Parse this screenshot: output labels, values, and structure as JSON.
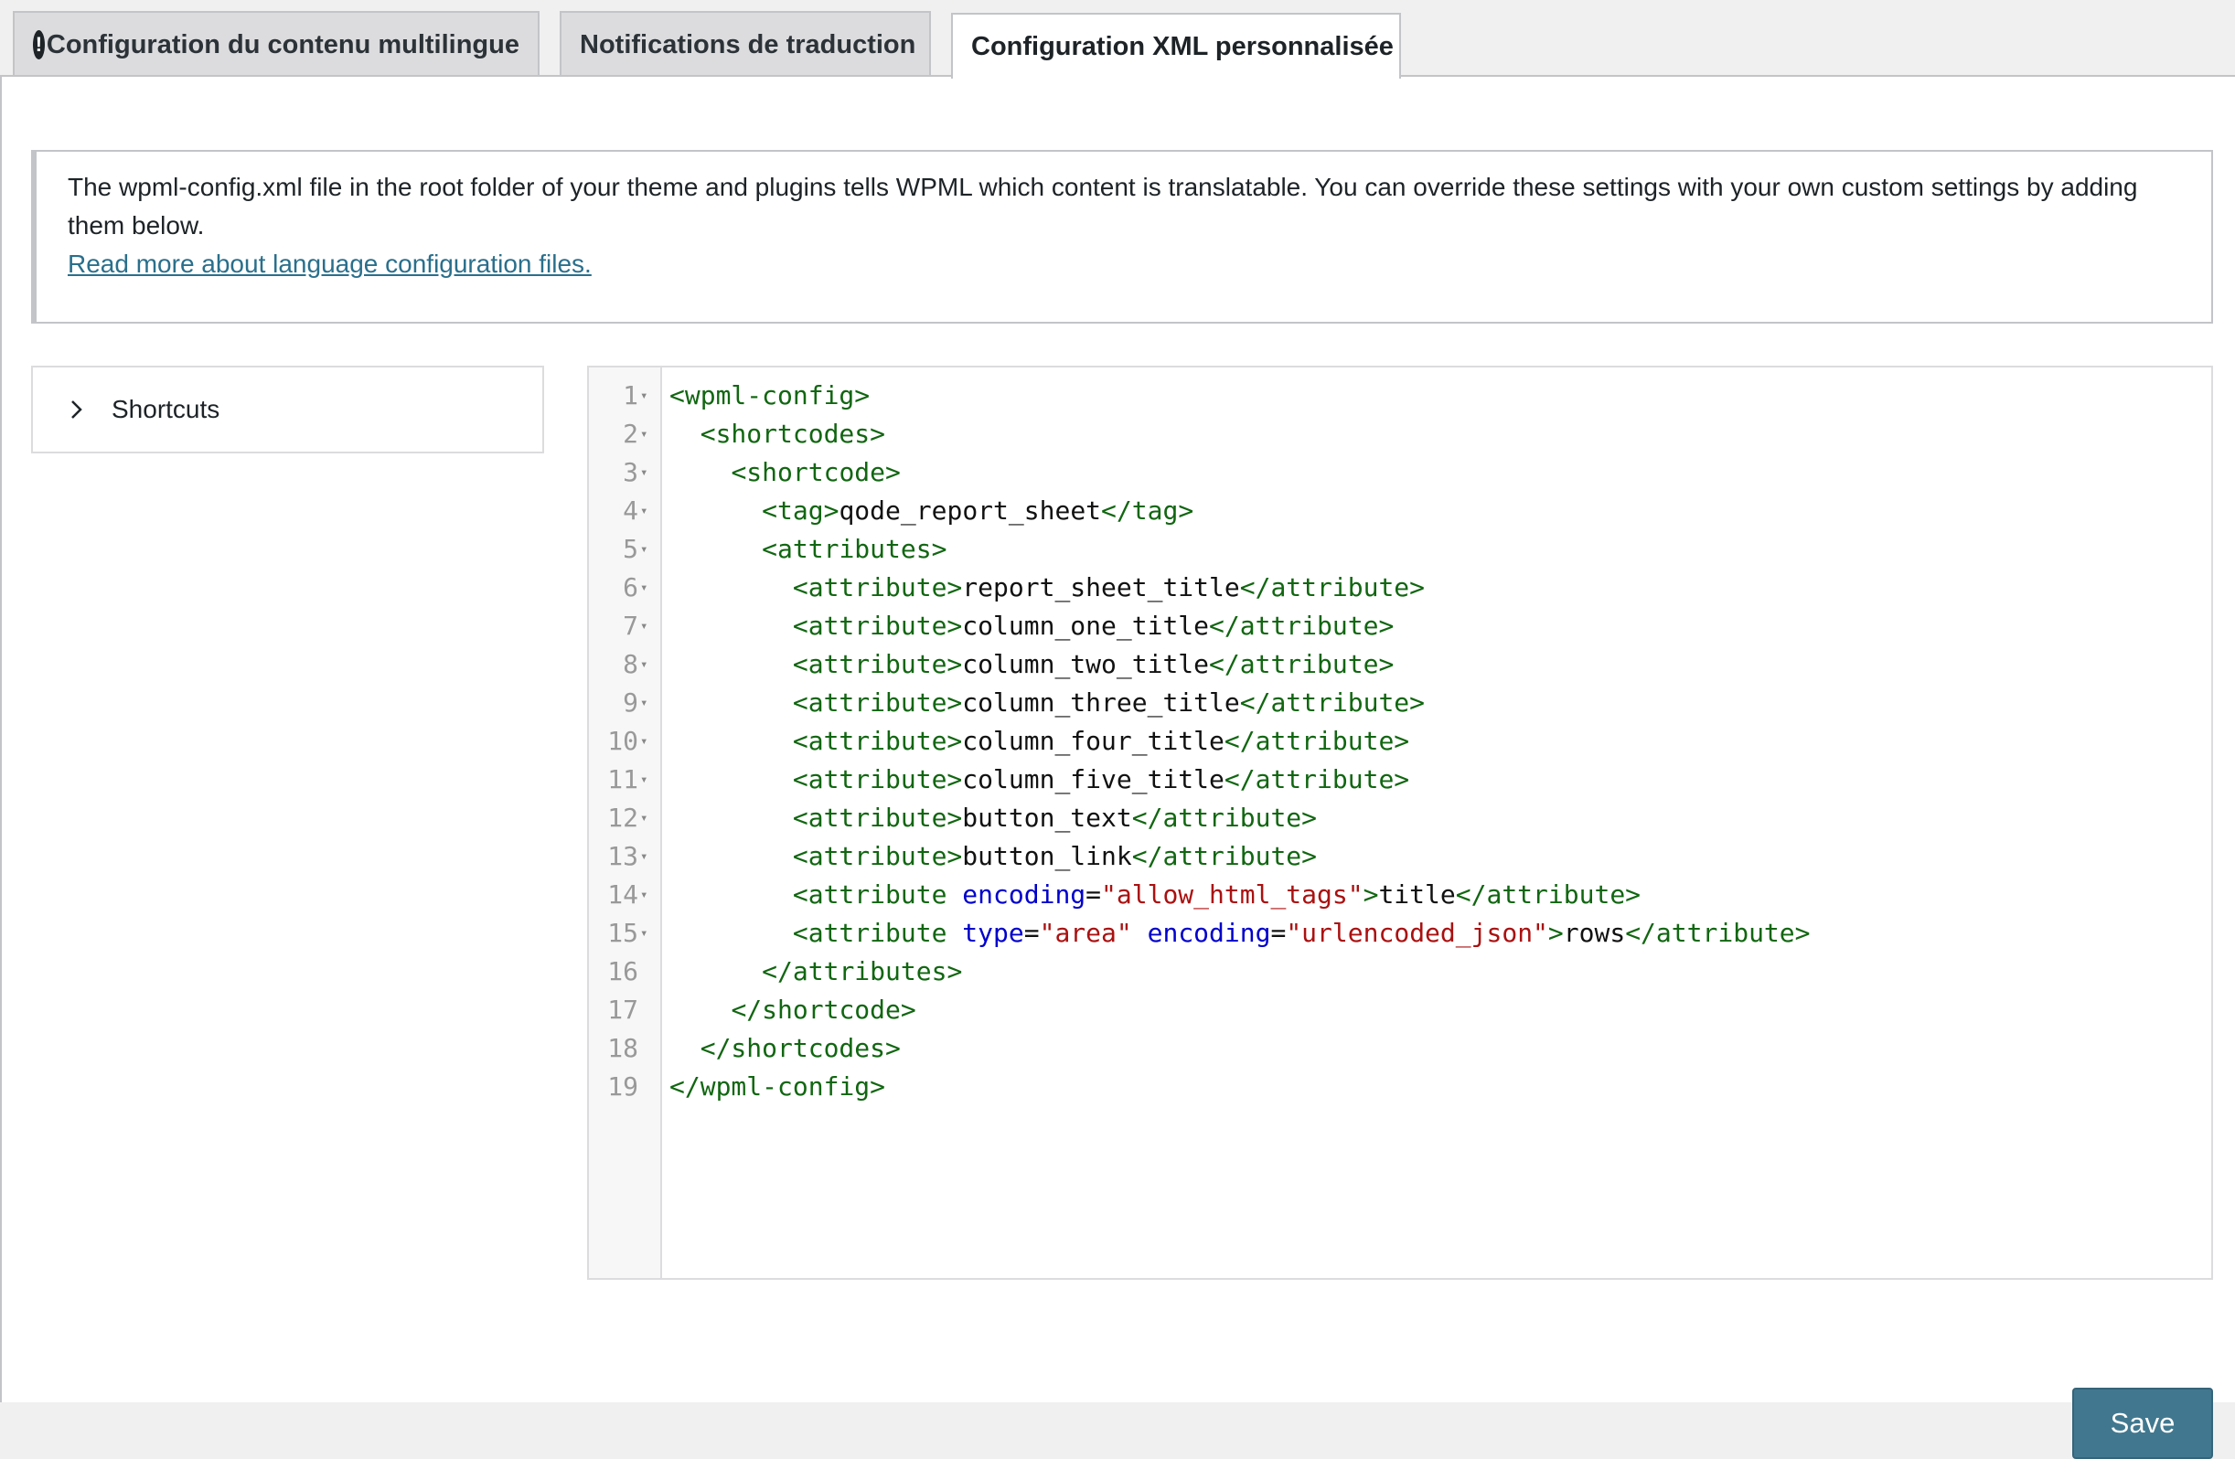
{
  "tabs": [
    {
      "label": "Configuration du contenu multilingue",
      "has_warning": true,
      "warning_glyph": "!"
    },
    {
      "label": "Notifications de traduction"
    },
    {
      "label": "Configuration XML personnalisée",
      "active": true
    }
  ],
  "notice": {
    "text": "The wpml-config.xml file in the root folder of your theme and plugins tells WPML which content is translatable. You can override these settings with your own custom settings by adding them below.",
    "link": "Read more about language configuration files."
  },
  "shortcuts": {
    "label": "Shortcuts",
    "icon": "chevron-right-icon"
  },
  "editor": {
    "lines": [
      {
        "n": "1",
        "fold": true,
        "indent": 0,
        "tokens": [
          [
            "tag",
            "<wpml-config>"
          ]
        ]
      },
      {
        "n": "2",
        "fold": true,
        "indent": 1,
        "tokens": [
          [
            "tag",
            "<shortcodes>"
          ]
        ]
      },
      {
        "n": "3",
        "fold": true,
        "indent": 2,
        "tokens": [
          [
            "tag",
            "<shortcode>"
          ]
        ]
      },
      {
        "n": "4",
        "fold": true,
        "indent": 3,
        "tokens": [
          [
            "tag",
            "<tag>"
          ],
          [
            "text",
            "qode_report_sheet"
          ],
          [
            "tag",
            "</tag>"
          ]
        ]
      },
      {
        "n": "5",
        "fold": true,
        "indent": 3,
        "tokens": [
          [
            "tag",
            "<attributes>"
          ]
        ]
      },
      {
        "n": "6",
        "fold": true,
        "indent": 4,
        "tokens": [
          [
            "tag",
            "<attribute>"
          ],
          [
            "text",
            "report_sheet_title"
          ],
          [
            "tag",
            "</attribute>"
          ]
        ]
      },
      {
        "n": "7",
        "fold": true,
        "indent": 4,
        "tokens": [
          [
            "tag",
            "<attribute>"
          ],
          [
            "text",
            "column_one_title"
          ],
          [
            "tag",
            "</attribute>"
          ]
        ]
      },
      {
        "n": "8",
        "fold": true,
        "indent": 4,
        "tokens": [
          [
            "tag",
            "<attribute>"
          ],
          [
            "text",
            "column_two_title"
          ],
          [
            "tag",
            "</attribute>"
          ]
        ]
      },
      {
        "n": "9",
        "fold": true,
        "indent": 4,
        "tokens": [
          [
            "tag",
            "<attribute>"
          ],
          [
            "text",
            "column_three_title"
          ],
          [
            "tag",
            "</attribute>"
          ]
        ]
      },
      {
        "n": "10",
        "fold": true,
        "indent": 4,
        "tokens": [
          [
            "tag",
            "<attribute>"
          ],
          [
            "text",
            "column_four_title"
          ],
          [
            "tag",
            "</attribute>"
          ]
        ]
      },
      {
        "n": "11",
        "fold": true,
        "indent": 4,
        "tokens": [
          [
            "tag",
            "<attribute>"
          ],
          [
            "text",
            "column_five_title"
          ],
          [
            "tag",
            "</attribute>"
          ]
        ]
      },
      {
        "n": "12",
        "fold": true,
        "indent": 4,
        "tokens": [
          [
            "tag",
            "<attribute>"
          ],
          [
            "text",
            "button_text"
          ],
          [
            "tag",
            "</attribute>"
          ]
        ]
      },
      {
        "n": "13",
        "fold": true,
        "indent": 4,
        "tokens": [
          [
            "tag",
            "<attribute>"
          ],
          [
            "text",
            "button_link"
          ],
          [
            "tag",
            "</attribute>"
          ]
        ]
      },
      {
        "n": "14",
        "fold": true,
        "indent": 4,
        "tokens": [
          [
            "tag",
            "<attribute "
          ],
          [
            "attr",
            "encoding"
          ],
          [
            "eq",
            "="
          ],
          [
            "str",
            "\"allow_html_tags\""
          ],
          [
            "tag",
            ">"
          ],
          [
            "text",
            "title"
          ],
          [
            "tag",
            "</attribute>"
          ]
        ]
      },
      {
        "n": "15",
        "fold": true,
        "indent": 4,
        "tokens": [
          [
            "tag",
            "<attribute "
          ],
          [
            "attr",
            "type"
          ],
          [
            "eq",
            "="
          ],
          [
            "str",
            "\"area\""
          ],
          [
            "text",
            " "
          ],
          [
            "attr",
            "encoding"
          ],
          [
            "eq",
            "="
          ],
          [
            "str",
            "\"urlencoded_json\""
          ],
          [
            "tag",
            ">"
          ],
          [
            "text",
            "rows"
          ],
          [
            "tag",
            "</attribute>"
          ]
        ]
      },
      {
        "n": "16",
        "fold": false,
        "indent": 3,
        "tokens": [
          [
            "tag",
            "</attributes>"
          ]
        ]
      },
      {
        "n": "17",
        "fold": false,
        "indent": 2,
        "tokens": [
          [
            "tag",
            "</shortcode>"
          ]
        ]
      },
      {
        "n": "18",
        "fold": false,
        "indent": 1,
        "tokens": [
          [
            "tag",
            "</shortcodes>"
          ]
        ]
      },
      {
        "n": "19",
        "fold": false,
        "indent": 0,
        "tokens": [
          [
            "tag",
            "</wpml-config>"
          ]
        ]
      }
    ]
  },
  "save_button": {
    "label": "Save"
  },
  "colors": {
    "accent": "#41788f",
    "tag": "#116611",
    "attr": "#0000cc",
    "string": "#aa1111"
  }
}
